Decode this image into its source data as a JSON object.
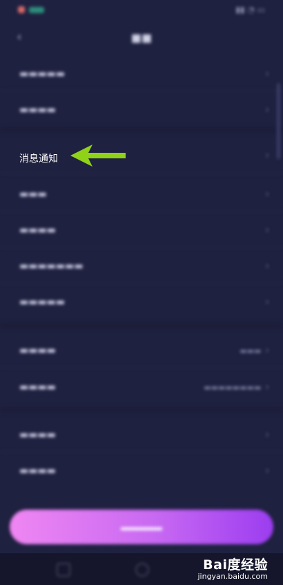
{
  "status_bar": {
    "time": "",
    "icons": ""
  },
  "header": {
    "back_icon": "back-arrow-icon",
    "title": ""
  },
  "rows": [
    {
      "label": "",
      "value": ""
    },
    {
      "label": "",
      "value": ""
    },
    {
      "label": "消息通知",
      "value": ""
    },
    {
      "label": "",
      "value": ""
    },
    {
      "label": "",
      "value": ""
    },
    {
      "label": "",
      "value": ""
    },
    {
      "label": "",
      "value": ""
    },
    {
      "label": "",
      "value": ""
    },
    {
      "label": "",
      "value": ""
    },
    {
      "label": "",
      "value": ""
    },
    {
      "label": "",
      "value": ""
    }
  ],
  "cta": {
    "label": ""
  },
  "annotation": {
    "color": "#8fd218"
  },
  "watermark": {
    "brand": "Bai度经验",
    "url": "jingyan.baidu.com"
  },
  "colors": {
    "background": "#1f2140",
    "cta_start": "#ef86f2",
    "cta_end": "#9c3df0"
  }
}
